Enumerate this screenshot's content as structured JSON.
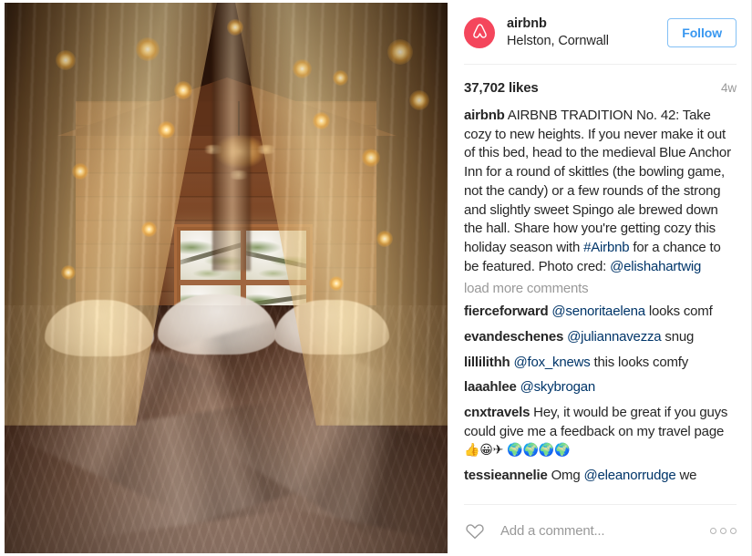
{
  "header": {
    "avatar_icon": "airbnb-belo-logo",
    "username": "airbnb",
    "location": "Helston, Cornwall",
    "follow_label": "Follow",
    "follow_color": "#3897f0",
    "avatar_bg": "#f4465c"
  },
  "stats": {
    "likes": "37,702 likes",
    "time": "4w"
  },
  "caption": {
    "username": "airbnb",
    "text_before_tag": " AIRBNB TRADITION No. 42: Take cozy to new heights. If you never make it out of this bed, head to the medieval Blue Anchor Inn for a round of skittles (the bowling game, not the candy) or a few rounds of the strong and slightly sweet Spingo ale brewed down the hall. Share how you're getting cozy this holiday season with ",
    "hashtag": "#Airbnb",
    "text_after_tag": " for a chance to be featured. Photo cred: ",
    "mention": "@elishahartwig"
  },
  "load_more_label": "load more comments",
  "comments": [
    {
      "username": "fierceforward",
      "mention": "@senoritaelena",
      "text": " looks comf"
    },
    {
      "username": "evandeschenes",
      "mention": "@juliannavezza",
      "text": " snug"
    },
    {
      "username": "lillilithh",
      "mention": "@fox_knews",
      "text": " this looks comfy"
    },
    {
      "username": "laaahlee",
      "mention": "@skybrogan",
      "text": ""
    },
    {
      "username": "cnxtravels",
      "mention": "",
      "text": " Hey, it would be great if you guys could give me a feedback on my travel page ",
      "emoji": "👍😀✈ 🌍🌍🌍🌍"
    },
    {
      "username": "tessieannelie",
      "pre_text": " Omg ",
      "mention": "@eleanorrudge",
      "text": " we"
    }
  ],
  "addbar": {
    "heart_icon": "heart-outline-icon",
    "placeholder": "Add a comment...",
    "value": "",
    "more_icon": "more-options-icon"
  },
  "photo": {
    "alt_name": "cozy-attic-bedroom-photo"
  }
}
